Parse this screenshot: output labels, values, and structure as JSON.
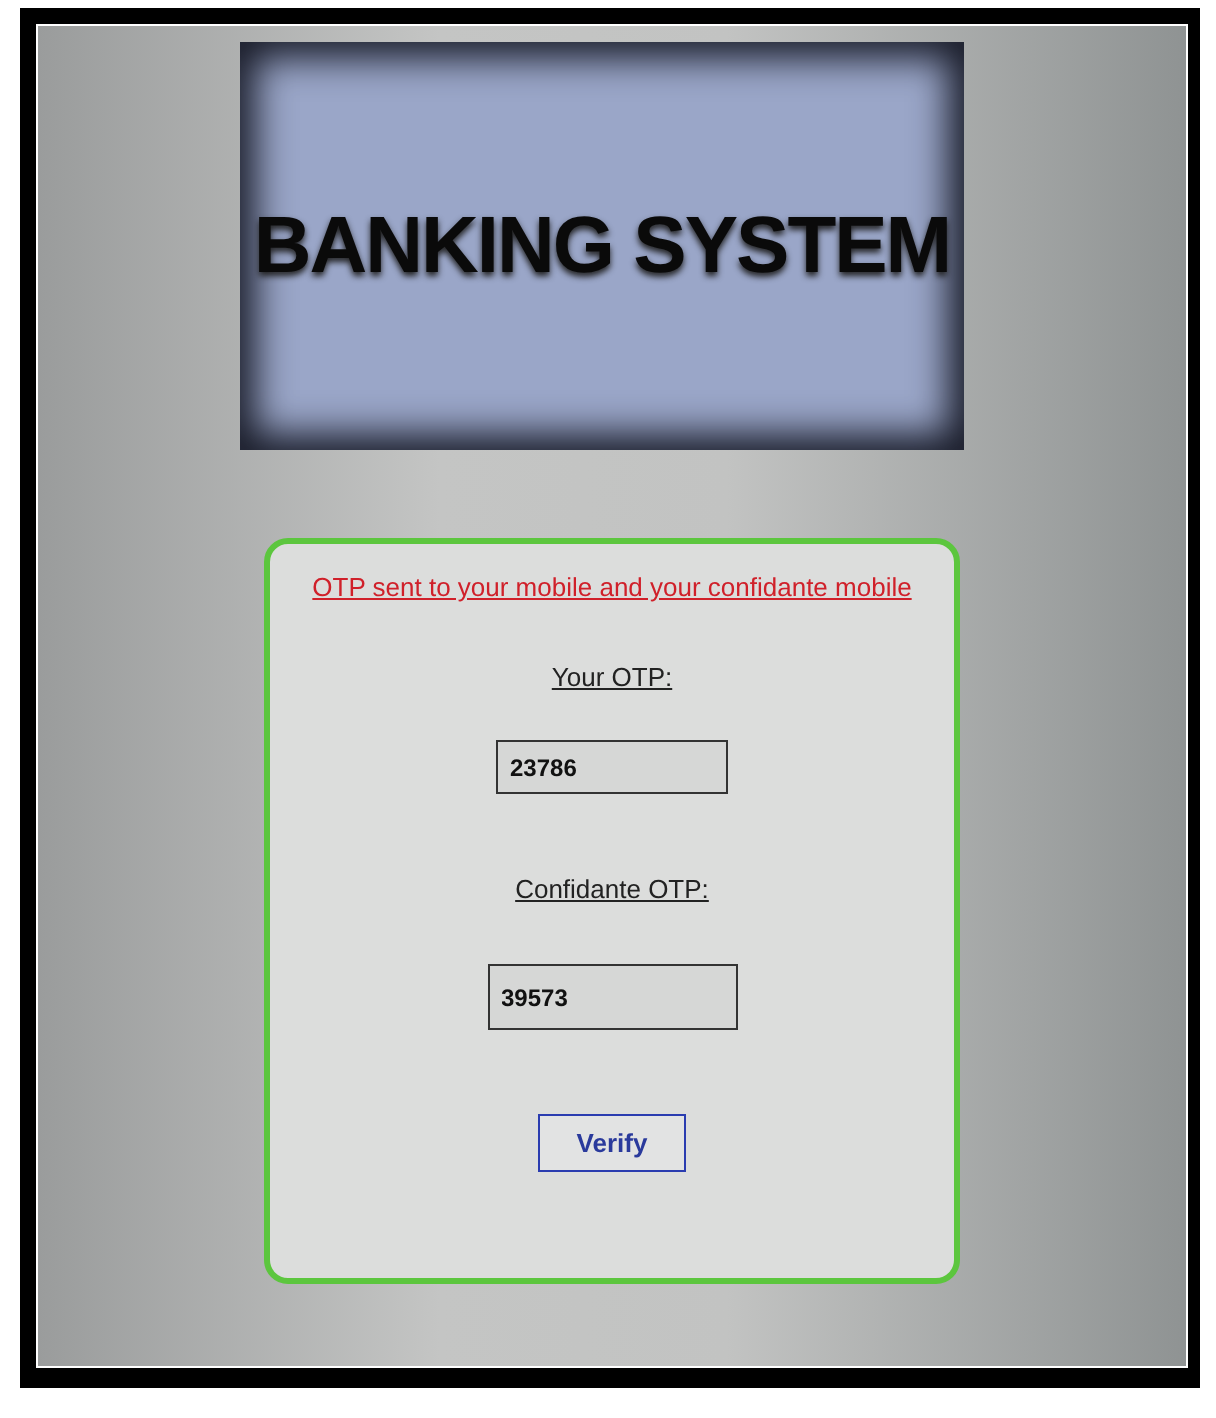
{
  "banner": {
    "title": "BANKING SYSTEM"
  },
  "form": {
    "message": "OTP sent to your mobile and your confidante  mobile",
    "fields": [
      {
        "label": "Your OTP:",
        "value": "23786"
      },
      {
        "label": "Confidante OTP:",
        "value": "39573"
      }
    ],
    "button": "Verify"
  }
}
